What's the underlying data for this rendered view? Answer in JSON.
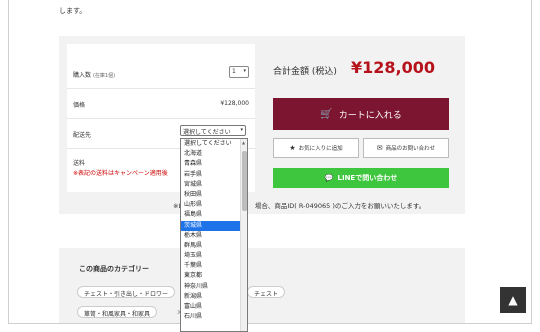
{
  "intro_text": "します。",
  "purchase": {
    "qty_label": "購入数",
    "qty_unit": "(在庫1個)",
    "qty_value": "1",
    "price_label": "価格",
    "price_value": "¥128,000",
    "dest_label": "配送先",
    "dest_selected": "選択してください",
    "shipping_label": "送料",
    "shipping_note": "※表記の送料はキャンペーン適用後",
    "total_label": "合計金額 (税込)",
    "total_value": "¥128,000",
    "cart_label": "カートに入れる",
    "fav_label": "お気に入りに追加",
    "inquiry_label": "商品のお問い合わせ",
    "line_label": "LINEで問い合わせ",
    "id_note_prefix": "※LIN",
    "id_note": "場合、商品ID( R-049065 )のご入力をお願いいたします。"
  },
  "dropdown": {
    "options": [
      "選択してください",
      "北海道",
      "青森県",
      "岩手県",
      "宮城県",
      "秋田県",
      "山形県",
      "福島県",
      "茨城県",
      "栃木県",
      "群馬県",
      "埼玉県",
      "千葉県",
      "東京都",
      "神奈川県",
      "新潟県",
      "富山県",
      "石川県"
    ],
    "selected_index": 8
  },
  "category": {
    "title": "この商品のカテゴリー",
    "chip1": "チェスト・引き出し・ドロワー",
    "chip1_tail": "チェスト",
    "chip2": "箪笥・和風家具・和家具",
    "sep": ">"
  },
  "colors": {
    "accent": "#7b1530",
    "price": "#b5121b",
    "line": "#3ec63e",
    "selected": "#1e73e8"
  },
  "icons": {
    "cart": "cart-icon",
    "star": "star-icon",
    "mail": "mail-icon",
    "line": "line-chat-icon",
    "pagetop": "arrow-up-icon"
  }
}
